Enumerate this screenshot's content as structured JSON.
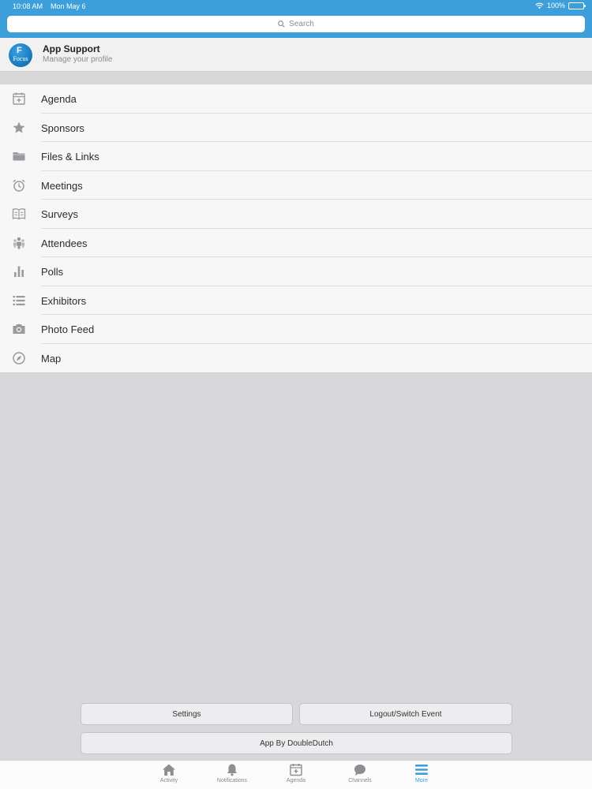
{
  "status_bar": {
    "time": "10:08 AM",
    "date": "Mon May 6",
    "battery": "100%"
  },
  "search": {
    "placeholder": "Search"
  },
  "profile": {
    "name": "App Support",
    "subtitle": "Manage your profile",
    "logo_text": "Focus",
    "logo_letter": "F"
  },
  "menu": {
    "items": [
      {
        "label": "Agenda",
        "icon": "calendar-icon"
      },
      {
        "label": "Sponsors",
        "icon": "star-icon"
      },
      {
        "label": "Files & Links",
        "icon": "folder-icon"
      },
      {
        "label": "Meetings",
        "icon": "alarm-clock-icon"
      },
      {
        "label": "Surveys",
        "icon": "book-icon"
      },
      {
        "label": "Attendees",
        "icon": "people-icon"
      },
      {
        "label": "Polls",
        "icon": "bar-chart-icon"
      },
      {
        "label": "Exhibitors",
        "icon": "list-icon"
      },
      {
        "label": "Photo Feed",
        "icon": "camera-icon"
      },
      {
        "label": "Map",
        "icon": "compass-icon"
      }
    ]
  },
  "buttons": {
    "settings": "Settings",
    "logout": "Logout/Switch Event",
    "app_by": "App By DoubleDutch"
  },
  "tabs": [
    {
      "label": "Activity",
      "icon": "home-icon"
    },
    {
      "label": "Notifications",
      "icon": "bell-icon"
    },
    {
      "label": "Agenda",
      "icon": "calendar-icon"
    },
    {
      "label": "Channels",
      "icon": "chat-bubble-icon"
    },
    {
      "label": "More",
      "icon": "menu-icon",
      "active": true
    }
  ],
  "colors": {
    "accent": "#3c9fd9",
    "icon_gray": "#9a9a9e",
    "background": "#d8d7da"
  }
}
